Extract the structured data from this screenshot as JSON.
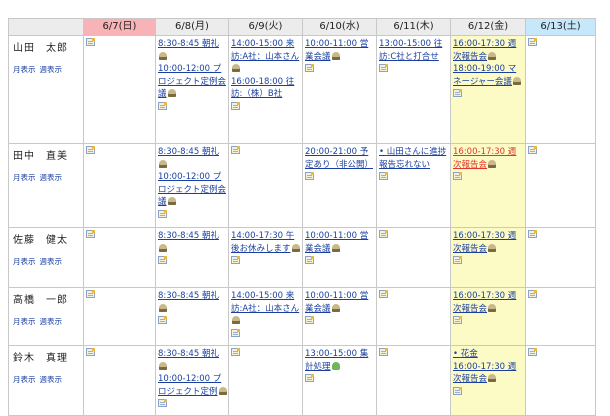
{
  "header": {
    "days": [
      "6/7(日)",
      "6/8(月)",
      "6/9(火)",
      "6/10(水)",
      "6/11(木)",
      "6/12(金)",
      "6/13(土)"
    ]
  },
  "links": {
    "month": "月表示",
    "week": "週表示"
  },
  "rows": [
    {
      "name": "山田　太郎",
      "cells": [
        {
          "events": []
        },
        {
          "events": [
            {
              "text": "8:30-8:45 朝礼",
              "icon": "person"
            },
            {
              "text": "10:00-12:00 プロジェクト定例会議",
              "icon": "person"
            }
          ]
        },
        {
          "events": [
            {
              "text": "14:00-15:00 来訪:A社：山本さん",
              "icon": "person"
            },
            {
              "text": "16:00-18:00 往訪:（株）B社"
            }
          ]
        },
        {
          "events": [
            {
              "text": "10:00-11:00 営業会議",
              "icon": "person"
            }
          ]
        },
        {
          "events": [
            {
              "text": "13:00-15:00 往訪:C社と打合せ"
            }
          ]
        },
        {
          "events": [
            {
              "text": "16:00-17:30 週次報告会",
              "icon": "person"
            },
            {
              "text": "18:00-19:00 マネージャー会議",
              "icon": "person"
            }
          ]
        },
        {
          "events": []
        }
      ]
    },
    {
      "name": "田中　直美",
      "cells": [
        {
          "events": []
        },
        {
          "events": [
            {
              "text": "8:30-8:45 朝礼",
              "icon": "person"
            },
            {
              "text": "10:00-12:00 プロジェクト定例会議",
              "icon": "person"
            }
          ]
        },
        {
          "events": []
        },
        {
          "events": [
            {
              "text": "20:00-21:00 予定あり（非公開）"
            }
          ]
        },
        {
          "events": [
            {
              "text": "山田さんに進捗報告忘れない",
              "bullet": "•"
            }
          ]
        },
        {
          "events": [
            {
              "text": "16:00-17:30 週次報告会",
              "icon": "person",
              "red": true
            }
          ]
        },
        {
          "events": []
        }
      ]
    },
    {
      "name": "佐藤　健太",
      "cells": [
        {
          "events": []
        },
        {
          "events": [
            {
              "text": "8:30-8:45 朝礼",
              "icon": "person"
            }
          ]
        },
        {
          "events": [
            {
              "text": "14:00-17:30 午後お休みします",
              "icon": "person"
            }
          ]
        },
        {
          "events": [
            {
              "text": "10:00-11:00 営業会議",
              "icon": "person"
            }
          ]
        },
        {
          "events": []
        },
        {
          "events": [
            {
              "text": "16:00-17:30 週次報告会",
              "icon": "person"
            }
          ]
        },
        {
          "events": []
        }
      ]
    },
    {
      "name": "高橋　一郎",
      "cells": [
        {
          "events": []
        },
        {
          "events": [
            {
              "text": "8:30-8:45 朝礼",
              "icon": "person"
            }
          ]
        },
        {
          "events": [
            {
              "text": "14:00-15:00 来訪:A社：山本さん",
              "icon": "person"
            }
          ]
        },
        {
          "events": [
            {
              "text": "10:00-11:00 営業会議",
              "icon": "person"
            }
          ]
        },
        {
          "events": []
        },
        {
          "events": [
            {
              "text": "16:00-17:30 週次報告会",
              "icon": "person"
            }
          ]
        },
        {
          "events": []
        }
      ]
    },
    {
      "name": "鈴木　真理",
      "cells": [
        {
          "events": []
        },
        {
          "events": [
            {
              "text": "8:30-8:45 朝礼",
              "icon": "person"
            },
            {
              "text": "10:00-12:00 プロジェクト定例",
              "icon": "person"
            }
          ]
        },
        {
          "events": []
        },
        {
          "events": [
            {
              "text": "13:00-15:00 集計処理",
              "icon": "plant"
            }
          ]
        },
        {
          "events": []
        },
        {
          "events": [
            {
              "text": "花金",
              "bullet": "•"
            },
            {
              "text": "16:00-17:30 週次報告会",
              "icon": "person"
            }
          ]
        },
        {
          "events": []
        }
      ]
    }
  ]
}
